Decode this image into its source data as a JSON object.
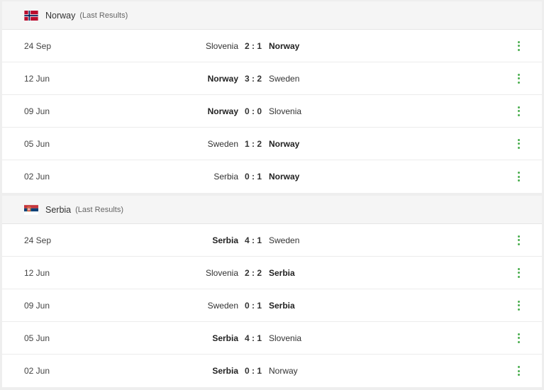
{
  "colors": {
    "accent": "#4caf50"
  },
  "sections": [
    {
      "team": "Norway",
      "subtitle": "(Last Results)",
      "flag_icon": "norway-flag-icon",
      "matches": [
        {
          "date": "24 Sep",
          "home": "Slovenia",
          "score": "2 : 1",
          "away": "Norway",
          "winner": "away"
        },
        {
          "date": "12 Jun",
          "home": "Norway",
          "score": "3 : 2",
          "away": "Sweden",
          "winner": "home"
        },
        {
          "date": "09 Jun",
          "home": "Norway",
          "score": "0 : 0",
          "away": "Slovenia",
          "winner": "home"
        },
        {
          "date": "05 Jun",
          "home": "Sweden",
          "score": "1 : 2",
          "away": "Norway",
          "winner": "away"
        },
        {
          "date": "02 Jun",
          "home": "Serbia",
          "score": "0 : 1",
          "away": "Norway",
          "winner": "away"
        }
      ]
    },
    {
      "team": "Serbia",
      "subtitle": "(Last Results)",
      "flag_icon": "serbia-flag-icon",
      "matches": [
        {
          "date": "24 Sep",
          "home": "Serbia",
          "score": "4 : 1",
          "away": "Sweden",
          "winner": "home"
        },
        {
          "date": "12 Jun",
          "home": "Slovenia",
          "score": "2 : 2",
          "away": "Serbia",
          "winner": "away"
        },
        {
          "date": "09 Jun",
          "home": "Sweden",
          "score": "0 : 1",
          "away": "Serbia",
          "winner": "away"
        },
        {
          "date": "05 Jun",
          "home": "Serbia",
          "score": "4 : 1",
          "away": "Slovenia",
          "winner": "home"
        },
        {
          "date": "02 Jun",
          "home": "Serbia",
          "score": "0 : 1",
          "away": "Norway",
          "winner": "home"
        }
      ]
    }
  ]
}
